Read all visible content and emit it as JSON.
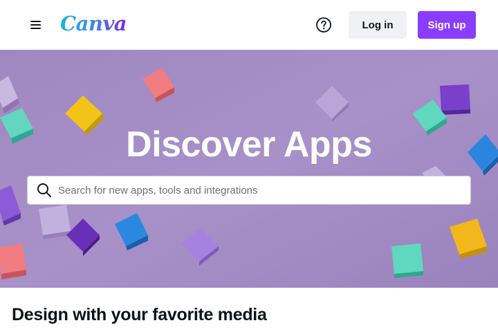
{
  "header": {
    "brand_name": "Canva",
    "menu_icon": "hamburger-menu-icon",
    "help_icon": "help-circle-icon",
    "login_label": "Log in",
    "signup_label": "Sign up"
  },
  "hero": {
    "title": "Discover Apps",
    "search_placeholder": "Search for new apps, tools and integrations",
    "search_value": "",
    "search_icon": "search-icon"
  },
  "section": {
    "title": "Design with your favorite media"
  },
  "colors": {
    "brand_purple": "#8b3dff",
    "hero_background": "#a58fc4",
    "login_background": "#f0f1f5",
    "text_primary": "#0e1318",
    "logo_gradient_start": "#1fb6d6",
    "logo_gradient_end": "#7d2ae8"
  }
}
